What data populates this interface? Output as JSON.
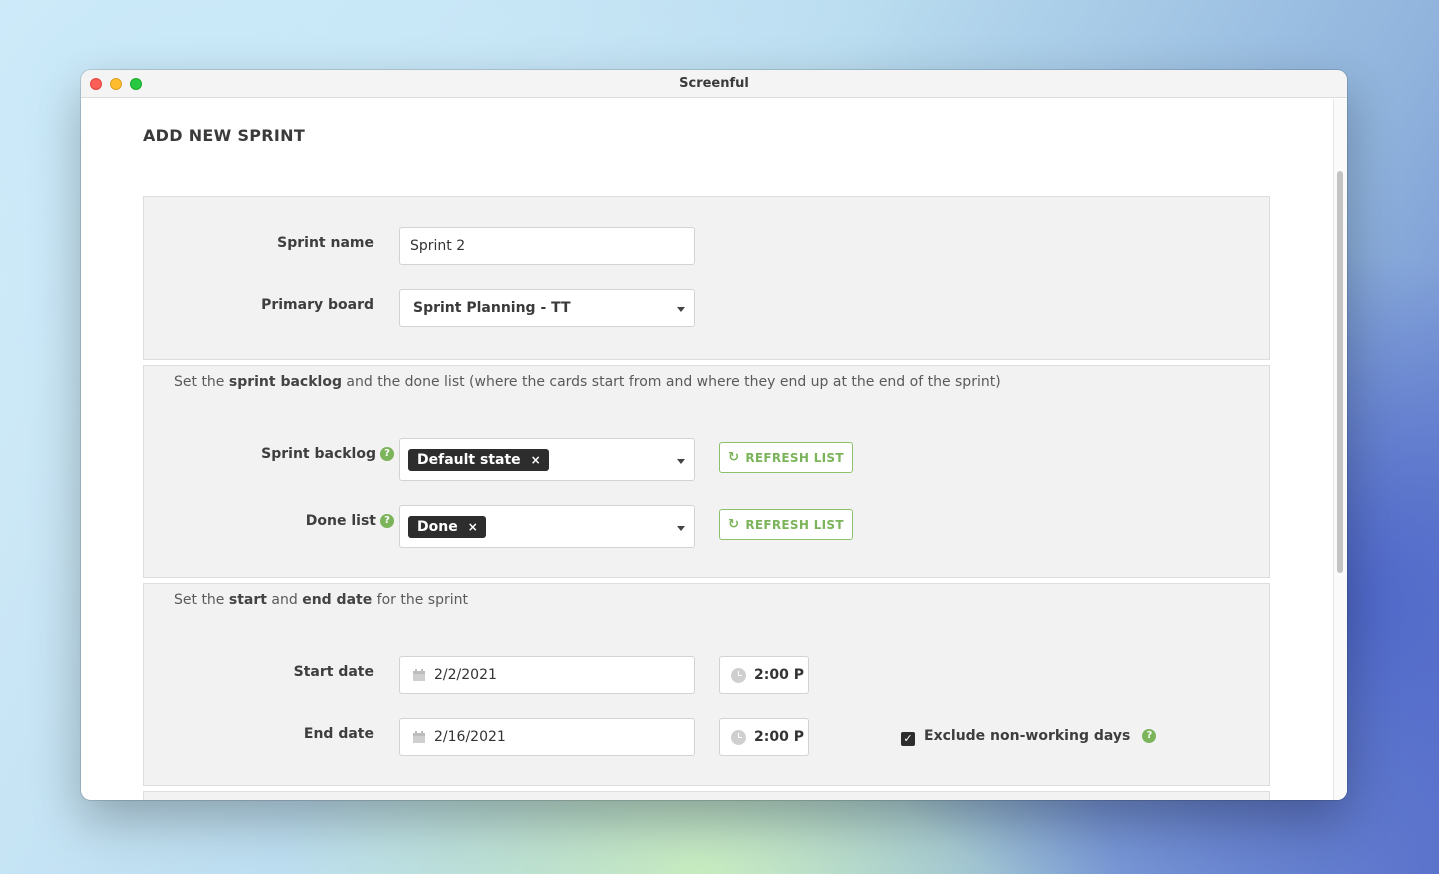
{
  "window": {
    "title": "Screenful"
  },
  "page": {
    "title": "ADD NEW SPRINT"
  },
  "basics": {
    "sprint_name_label": "Sprint name",
    "sprint_name_value": "Sprint 2",
    "primary_board_label": "Primary board",
    "primary_board_value": "Sprint Planning - TT"
  },
  "lists": {
    "desc_prefix": "Set the ",
    "desc_bold": "sprint backlog",
    "desc_suffix": " and the done list (where the cards start from and where they end up at the end of the sprint)",
    "sprint_backlog_label": "Sprint backlog",
    "sprint_backlog_chip": "Default state",
    "done_list_label": "Done list",
    "done_list_chip": "Done",
    "refresh_label": "REFRESH LIST",
    "help_glyph": "?",
    "chip_remove_glyph": "×"
  },
  "dates": {
    "desc_prefix": "Set the ",
    "desc_bold_start": "start",
    "desc_mid": " and ",
    "desc_bold_end": "end date",
    "desc_suffix": " for the sprint",
    "start_label": "Start date",
    "start_value": "2/2/2021",
    "start_time": "2:00 P",
    "end_label": "End date",
    "end_value": "2/16/2021",
    "end_time": "2:00 P",
    "exclude_label": "Exclude non-working days",
    "exclude_checked": true,
    "check_glyph": "✓"
  },
  "colors": {
    "accent_green": "#7bb45a",
    "chip_dark": "#2d2d2d"
  },
  "icons": {
    "refresh": "refresh-icon",
    "calendar": "calendar-icon",
    "clock": "clock-icon",
    "help": "help-icon",
    "dropdown": "chevron-down-icon"
  }
}
